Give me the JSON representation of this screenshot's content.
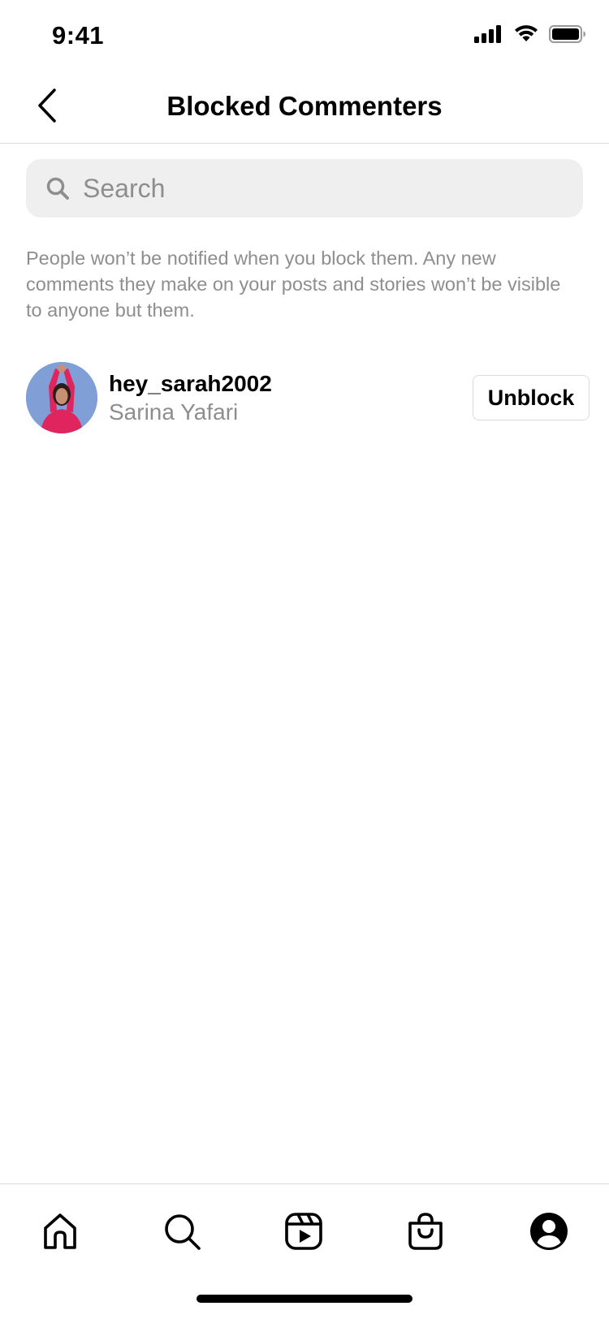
{
  "status_bar": {
    "time": "9:41"
  },
  "header": {
    "title": "Blocked Commenters"
  },
  "search": {
    "placeholder": "Search",
    "value": ""
  },
  "info_text": "People won’t be notified when you block them. Any new comments they make on your posts and stories won’t be visible to anyone but them.",
  "blocked_users": [
    {
      "username": "hey_sarah2002",
      "full_name": "Sarina Yafari",
      "action_label": "Unblock"
    }
  ],
  "nav": {
    "items": [
      "home-icon",
      "search-icon",
      "reels-icon",
      "shop-icon",
      "profile-icon"
    ]
  },
  "colors": {
    "secondary_text": "#8e8e8e",
    "divider": "#dbdbdb",
    "search_bg": "#efefef",
    "avatar_bg": "#7f9fd6",
    "avatar_shirt": "#e0245e"
  }
}
